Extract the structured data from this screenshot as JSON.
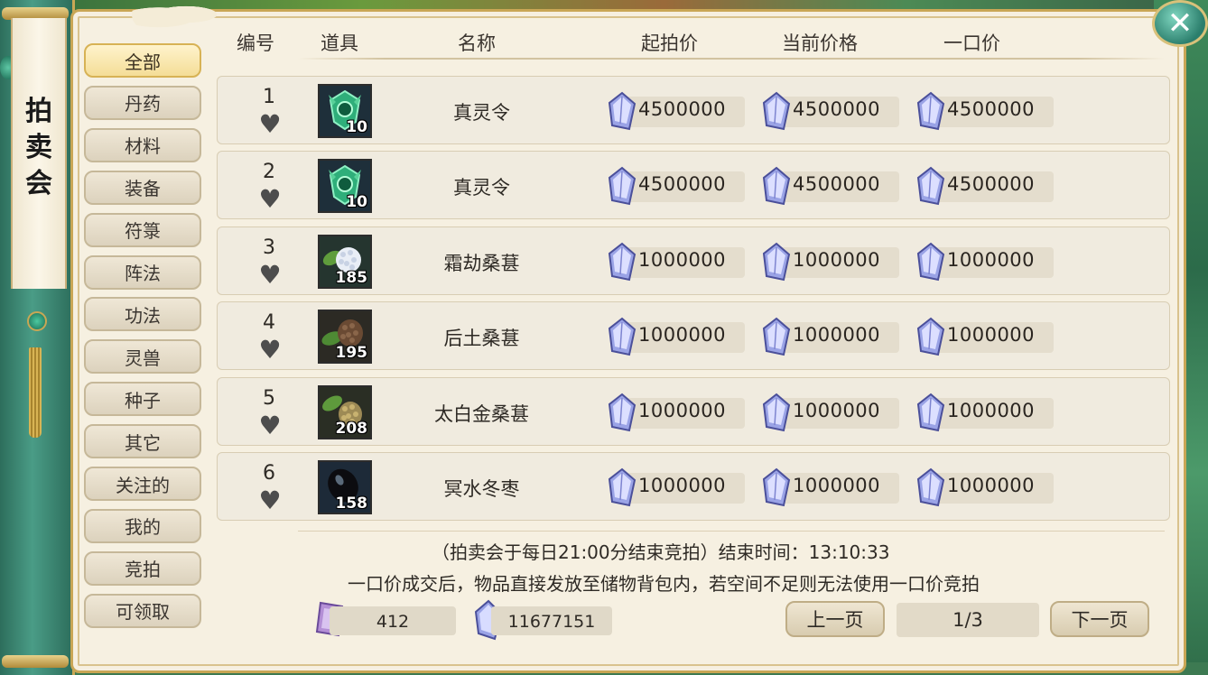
{
  "title": "拍卖会",
  "close_label": "✕",
  "categories": [
    {
      "label": "全部",
      "active": true
    },
    {
      "label": "丹药"
    },
    {
      "label": "材料"
    },
    {
      "label": "装备"
    },
    {
      "label": "符箓"
    },
    {
      "label": "阵法"
    },
    {
      "label": "功法"
    },
    {
      "label": "灵兽"
    },
    {
      "label": "种子"
    },
    {
      "label": "其它"
    },
    {
      "label": "关注的"
    },
    {
      "label": "我的"
    },
    {
      "label": "竞拍"
    },
    {
      "label": "可领取"
    }
  ],
  "headers": {
    "number": "编号",
    "item": "道具",
    "name": "名称",
    "start_price": "起拍价",
    "current_price": "当前价格",
    "buyout_price": "一口价"
  },
  "rows": [
    {
      "num": "1",
      "name": "真灵令",
      "qty": "10",
      "icon": "token-icon",
      "start": "4500000",
      "current": "4500000",
      "buyout": "4500000"
    },
    {
      "num": "2",
      "name": "真灵令",
      "qty": "10",
      "icon": "token-icon",
      "start": "4500000",
      "current": "4500000",
      "buyout": "4500000"
    },
    {
      "num": "3",
      "name": "霜劫桑葚",
      "qty": "185",
      "icon": "white-mulberry-icon",
      "start": "1000000",
      "current": "1000000",
      "buyout": "1000000"
    },
    {
      "num": "4",
      "name": "后土桑葚",
      "qty": "195",
      "icon": "brown-mulberry-icon",
      "start": "1000000",
      "current": "1000000",
      "buyout": "1000000"
    },
    {
      "num": "5",
      "name": "太白金桑葚",
      "qty": "208",
      "icon": "gold-mulberry-icon",
      "start": "1000000",
      "current": "1000000",
      "buyout": "1000000"
    },
    {
      "num": "6",
      "name": "冥水冬枣",
      "qty": "158",
      "icon": "black-jujube-icon",
      "start": "1000000",
      "current": "1000000",
      "buyout": "1000000"
    }
  ],
  "notice_line1": "（拍卖会于每日21:00分结束竞拍）结束时间：13:10:33",
  "notice_line2": "一口价成交后，物品直接发放至储物背包内，若空间不足则无法使用一口价竞拍",
  "currency": {
    "card_amount": "412",
    "gem_amount": "11677151"
  },
  "pager": {
    "prev_label": "上一页",
    "page": "1/3",
    "next_label": "下一页"
  },
  "colors": {
    "panel_bg": "#f6f0e1",
    "gold_border": "#c9a655",
    "jade": "#2b7e6c",
    "gem": "#8a8fd6"
  }
}
